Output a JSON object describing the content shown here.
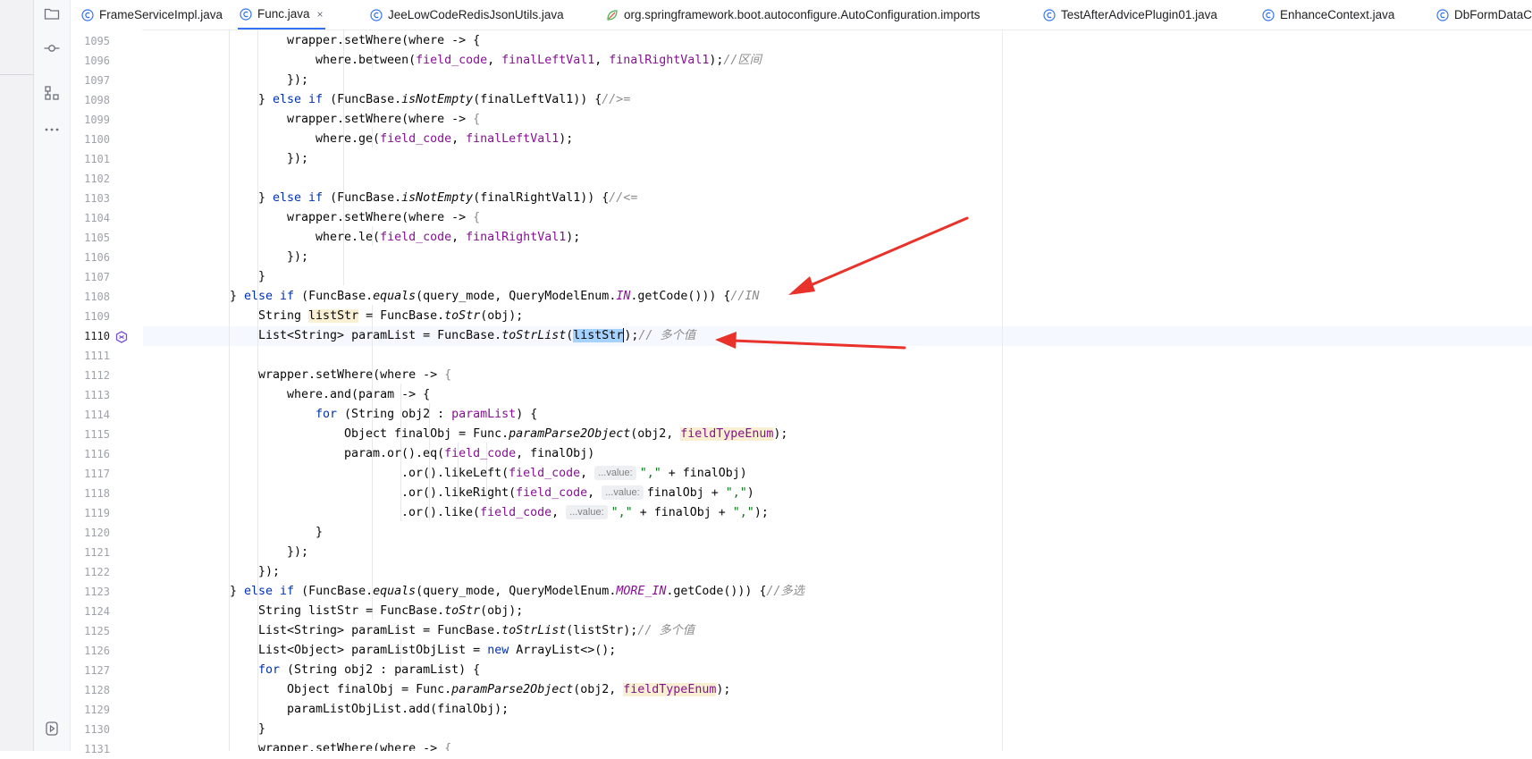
{
  "tabs": [
    {
      "label": "FrameServiceImpl.java",
      "icon": "class-icon",
      "active": false
    },
    {
      "label": "Func.java",
      "icon": "class-icon",
      "active": true,
      "close": "×"
    },
    {
      "label": "JeeLowCodeRedisJsonUtils.java",
      "icon": "class-icon",
      "active": false
    },
    {
      "label": "org.springframework.boot.autoconfigure.AutoConfiguration.imports",
      "icon": "spring-icon",
      "active": false
    },
    {
      "label": "TestAfterAdvicePlugin01.java",
      "icon": "class-icon",
      "active": false
    },
    {
      "label": "EnhanceContext.java",
      "icon": "class-icon",
      "active": false
    },
    {
      "label": "DbFormDataC",
      "icon": "class-icon",
      "active": false
    }
  ],
  "toolbar": {
    "icons": [
      "folder-icon",
      "commit-icon",
      "structure-icon",
      "more-icon",
      "run-services-icon"
    ]
  },
  "code": {
    "line_numbers": [
      "1095",
      "1096",
      "1097",
      "1098",
      "1099",
      "1100",
      "1101",
      "1102",
      "1103",
      "1104",
      "1105",
      "1106",
      "1107",
      "1108",
      "1109",
      "1110",
      "1111",
      "1112",
      "1113",
      "1114",
      "1115",
      "1116",
      "1117",
      "1118",
      "1119",
      "1120",
      "1121",
      "1122",
      "1123",
      "1124",
      "1125",
      "1126",
      "1127",
      "1128",
      "1129",
      "1130",
      "1131"
    ],
    "current_line": "1110",
    "inlay_hint": "...value:",
    "lines": {
      "l1095": {
        "a": "wrapper.setWhere(where -> {"
      },
      "l1096": {
        "a": "where.between(",
        "b": "field_code",
        "c": ", ",
        "d": "finalLeftVal1",
        "e": ", ",
        "f": "finalRightVal1",
        "g": ");",
        "h": "//区间"
      },
      "l1097": {
        "a": "});"
      },
      "l1098": {
        "a": "} ",
        "b": "else if",
        "c": " (FuncBase.",
        "d": "isNotEmpty",
        "e": "(finalLeftVal1)) {",
        "f": "//>="
      },
      "l1099": {
        "a": "wrapper.setWhere(where -> ",
        "b": "{"
      },
      "l1100": {
        "a": "where.ge(",
        "b": "field_code",
        "c": ", ",
        "d": "finalLeftVal1",
        "e": ");"
      },
      "l1101": {
        "a": "});"
      },
      "l1103": {
        "a": "} ",
        "b": "else if",
        "c": " (FuncBase.",
        "d": "isNotEmpty",
        "e": "(finalRightVal1)) {",
        "f": "//<="
      },
      "l1104": {
        "a": "wrapper.setWhere(where -> ",
        "b": "{"
      },
      "l1105": {
        "a": "where.le(",
        "b": "field_code",
        "c": ", ",
        "d": "finalRightVal1",
        "e": ");"
      },
      "l1106": {
        "a": "});"
      },
      "l1107": {
        "a": "}"
      },
      "l1108": {
        "a": "} ",
        "b": "else if",
        "c": " (FuncBase.",
        "d": "equals",
        "e": "(query_mode, QueryModelEnum.",
        "f": "IN",
        "g": ".getCode())) {",
        "h": "//IN"
      },
      "l1109": {
        "a": "String ",
        "b": "listStr",
        "c": " = FuncBase.",
        "d": "toStr",
        "e": "(obj);"
      },
      "l1110": {
        "a": "List<String> paramList = FuncBase.",
        "b": "toStrList",
        "c": "(",
        "d": "listStr",
        "e": ");",
        "f": "// 多个值"
      },
      "l1112": {
        "a": "wrapper.setWhere(where -> ",
        "b": "{"
      },
      "l1113": {
        "a": "where.and(param -> {"
      },
      "l1114": {
        "a": "for",
        "b": " (String obj2 : ",
        "c": "paramList",
        "d": ") {"
      },
      "l1115": {
        "a": "Object finalObj = Func.",
        "b": "paramParse2Object",
        "c": "(obj2, ",
        "d": "fieldTypeEnum",
        "e": ");"
      },
      "l1116": {
        "a": "param.or().eq(",
        "b": "field_code",
        "c": ", finalObj)"
      },
      "l1117": {
        "a": ".or().likeLeft(",
        "b": "field_code",
        "c": ", ",
        "d": "\",\"",
        "e": " + finalObj)"
      },
      "l1118": {
        "a": ".or().likeRight(",
        "b": "field_code",
        "c": ", ",
        "d": "finalObj + ",
        "e": "\",\"",
        "f": ")"
      },
      "l1119": {
        "a": ".or().like(",
        "b": "field_code",
        "c": ", ",
        "d": "\",\"",
        "e": " + finalObj + ",
        "f": "\",\"",
        "g": ");"
      },
      "l1120": {
        "a": "}"
      },
      "l1121": {
        "a": "});"
      },
      "l1122": {
        "a": "});"
      },
      "l1123": {
        "a": "} ",
        "b": "else if",
        "c": " (FuncBase.",
        "d": "equals",
        "e": "(query_mode, QueryModelEnum.",
        "f": "MORE_IN",
        "g": ".getCode())) {",
        "h": "//多选"
      },
      "l1124": {
        "a": "String listStr = FuncBase.",
        "b": "toStr",
        "c": "(obj);"
      },
      "l1125": {
        "a": "List<String> paramList = FuncBase.",
        "b": "toStrList",
        "c": "(listStr);",
        "d": "// 多个值"
      },
      "l1126": {
        "a": "List<Object> paramListObjList = ",
        "b": "new",
        "c": " ArrayList<>();"
      },
      "l1127": {
        "a": "for",
        "b": " (String obj2 : paramList) {"
      },
      "l1128": {
        "a": "Object finalObj = Func.",
        "b": "paramParse2Object",
        "c": "(obj2, ",
        "d": "fieldTypeEnum",
        "e": ");"
      },
      "l1129": {
        "a": "paramListObjList.add(finalObj);"
      },
      "l1130": {
        "a": "}"
      },
      "l1131": {
        "a": "wrapper.setWhere(where -> ",
        "b": "{"
      }
    }
  },
  "colors": {
    "keyword": "#0033b3",
    "field": "#871094",
    "comment": "#8c8c8c",
    "string": "#067d17",
    "annotation_arrow": "#e8322a",
    "selection": "#a6d2ff"
  }
}
